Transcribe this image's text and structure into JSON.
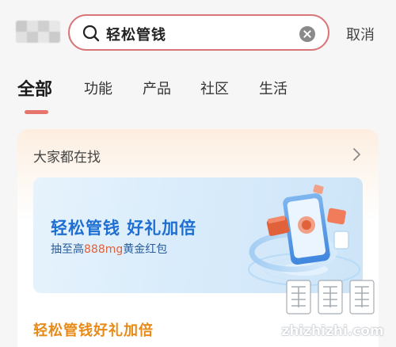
{
  "header": {
    "search_query": "轻松管钱",
    "cancel_label": "取消"
  },
  "tabs": [
    {
      "label": "全部",
      "active": true
    },
    {
      "label": "功能",
      "active": false
    },
    {
      "label": "产品",
      "active": false
    },
    {
      "label": "社区",
      "active": false
    },
    {
      "label": "生活",
      "active": false
    }
  ],
  "section": {
    "title": "大家都在找",
    "banner": {
      "title": "轻松管钱  好礼加倍",
      "sub_prefix": "抽至高",
      "sub_highlight": "888mg",
      "sub_suffix": "黄金红包"
    },
    "item_title": "轻松管钱好礼加倍"
  },
  "watermark": {
    "text": "zhizhizhi.com"
  },
  "colors": {
    "accent": "#e5756d",
    "search_border": "#d9767a",
    "banner_title": "#1e6fd1",
    "item_title": "#e88a18"
  }
}
